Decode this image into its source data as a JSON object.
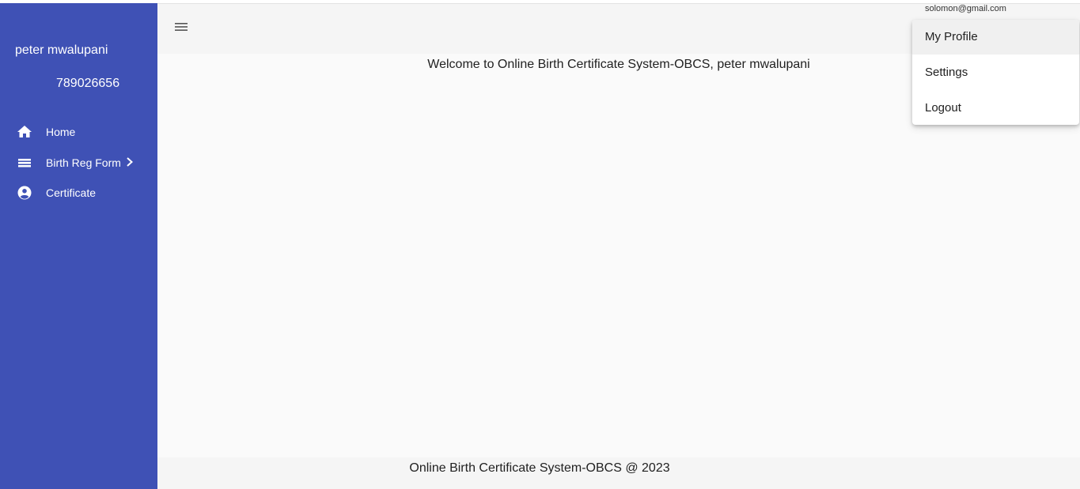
{
  "sidebar": {
    "user_name": "peter mwalupani",
    "user_phone": "789026656",
    "background_color": "#3f51b5",
    "items": [
      {
        "label": "Home",
        "icon": "home-icon"
      },
      {
        "label": "Birth Reg Form",
        "icon": "list-icon",
        "has_submenu": true
      },
      {
        "label": "Certificate",
        "icon": "account-circle-icon"
      }
    ]
  },
  "header": {
    "menu_icon": "menu-icon",
    "user_email": "solomon@gmail.com"
  },
  "main": {
    "welcome_text": "Welcome to Online Birth Certificate System-OBCS, peter mwalupani"
  },
  "footer": {
    "text": "Online Birth Certificate System-OBCS @ 2023"
  },
  "user_menu": {
    "items": [
      {
        "label": "My Profile",
        "highlighted": true
      },
      {
        "label": "Settings",
        "highlighted": false
      },
      {
        "label": "Logout",
        "highlighted": false
      }
    ]
  }
}
